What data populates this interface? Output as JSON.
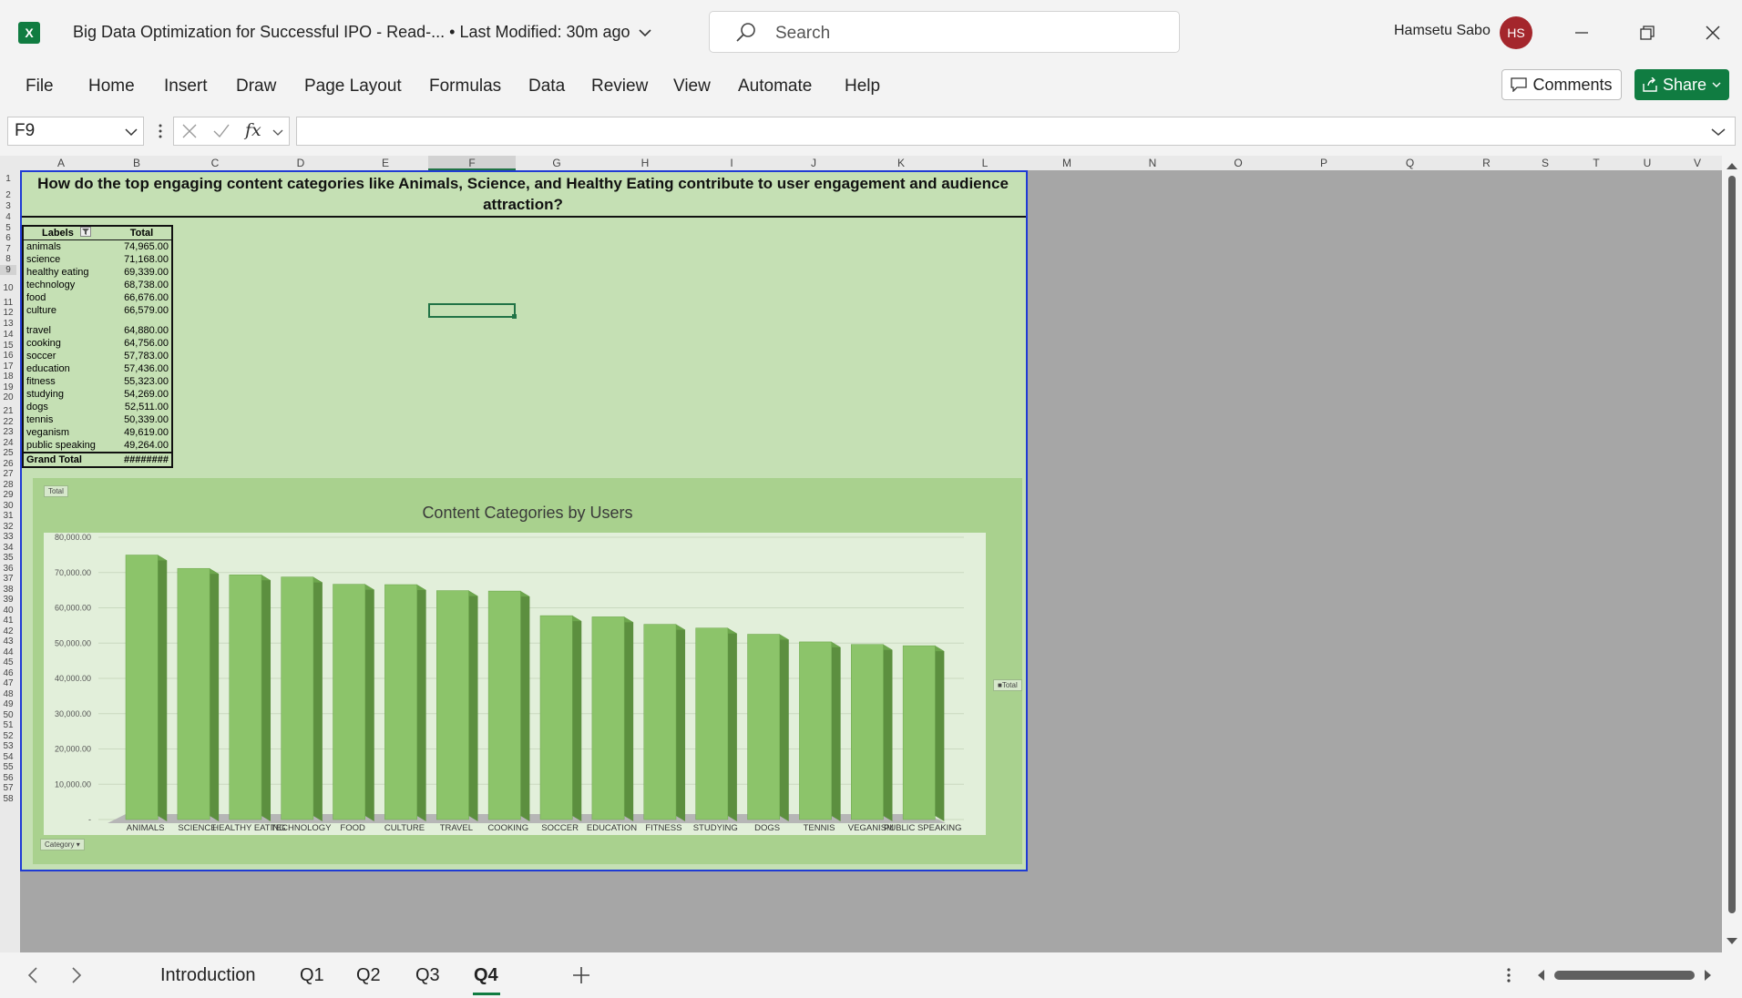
{
  "app": {
    "logo": "X",
    "title": "Big Data Optimization for Successful IPO  -  Read-...  • Last Modified: 30m ago",
    "search_placeholder": "Search",
    "user_name": "Hamsetu Sabo",
    "user_initials": "HS"
  },
  "menu": [
    "File",
    "Home",
    "Insert",
    "Draw",
    "Page Layout",
    "Formulas",
    "Data",
    "Review",
    "View",
    "Automate",
    "Help"
  ],
  "buttons": {
    "comments": "Comments",
    "share": "Share"
  },
  "formula_bar": {
    "cell_ref": "F9",
    "fx": "fx",
    "value": ""
  },
  "columns": [
    "A",
    "B",
    "C",
    "D",
    "E",
    "F",
    "G",
    "H",
    "I",
    "J",
    "K",
    "L",
    "M",
    "N",
    "O",
    "P",
    "Q",
    "R",
    "S",
    "T",
    "U",
    "V"
  ],
  "sheet": {
    "question": "How do the top engaging content categories like Animals, Science, and Healthy Eating contribute to user engagement and audience attraction?",
    "pivot_headers": {
      "labels": "Labels",
      "total": "Total"
    },
    "pivot_rows": [
      {
        "label": "animals",
        "total": "74,965.00"
      },
      {
        "label": "science",
        "total": "71,168.00"
      },
      {
        "label": "healthy eating",
        "total": "69,339.00"
      },
      {
        "label": "technology",
        "total": "68,738.00"
      },
      {
        "label": "food",
        "total": "66,676.00"
      },
      {
        "label": "culture",
        "total": "66,579.00"
      },
      {
        "label": "travel",
        "total": "64,880.00"
      },
      {
        "label": "cooking",
        "total": "64,756.00"
      },
      {
        "label": "soccer",
        "total": "57,783.00"
      },
      {
        "label": "education",
        "total": "57,436.00"
      },
      {
        "label": "fitness",
        "total": "55,323.00"
      },
      {
        "label": "studying",
        "total": "54,269.00"
      },
      {
        "label": "dogs",
        "total": "52,511.00"
      },
      {
        "label": "tennis",
        "total": "50,339.00"
      },
      {
        "label": "veganism",
        "total": "49,619.00"
      },
      {
        "label": "public speaking",
        "total": "49,264.00"
      }
    ],
    "grand_total": {
      "label": "Grand Total",
      "value": "########"
    }
  },
  "chart_data": {
    "type": "bar",
    "title": "Content Categories by Users",
    "categories": [
      "ANIMALS",
      "SCIENCE",
      "HEALTHY EATING",
      "TECHNOLOGY",
      "FOOD",
      "CULTURE",
      "TRAVEL",
      "COOKING",
      "SOCCER",
      "EDUCATION",
      "FITNESS",
      "STUDYING",
      "DOGS",
      "TENNIS",
      "VEGANISM",
      "PUBLIC SPEAKING"
    ],
    "series": [
      {
        "name": "Total",
        "values": [
          74965,
          71168,
          69339,
          68738,
          66676,
          66579,
          64880,
          64756,
          57783,
          57436,
          55323,
          54269,
          52511,
          50339,
          49619,
          49264
        ]
      }
    ],
    "ylim": [
      0,
      80000
    ],
    "yticks": [
      "-",
      "10,000.00",
      "20,000.00",
      "30,000.00",
      "40,000.00",
      "50,000.00",
      "60,000.00",
      "70,000.00",
      "80,000.00"
    ],
    "legend_position": "right",
    "legend_label": "Total",
    "field_buttons": {
      "top": "Total",
      "bottom": "Category"
    },
    "bar_color": "#8cc46a"
  },
  "tabs": [
    "Introduction",
    "Q1",
    "Q2",
    "Q3",
    "Q4"
  ],
  "active_tab": "Q4"
}
